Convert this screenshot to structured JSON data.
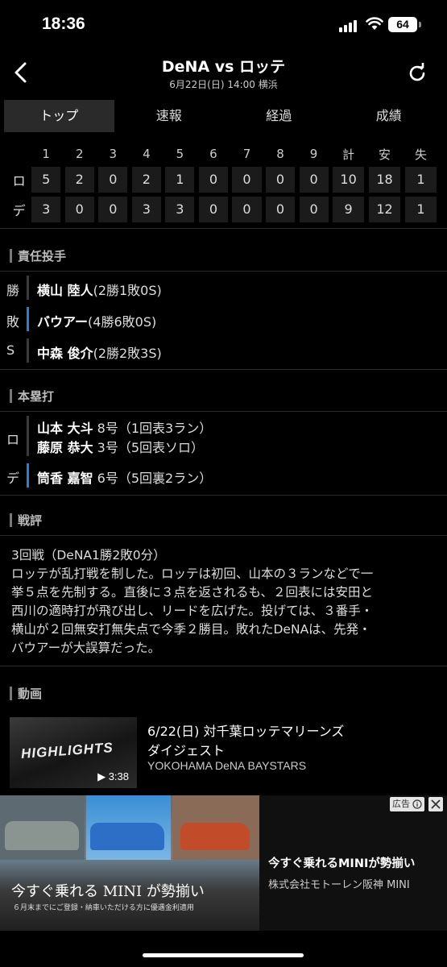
{
  "status_bar": {
    "time": "18:36",
    "battery": "64"
  },
  "header": {
    "title": "DeNA vs ロッテ",
    "subtitle": "6月22日(日) 14:00 横浜"
  },
  "tabs": [
    {
      "label": "トップ",
      "active": true
    },
    {
      "label": "速報",
      "active": false
    },
    {
      "label": "経過",
      "active": false
    },
    {
      "label": "成績",
      "active": false
    }
  ],
  "scoreboard": {
    "columns": [
      "1",
      "2",
      "3",
      "4",
      "5",
      "6",
      "7",
      "8",
      "9",
      "計",
      "安",
      "失"
    ],
    "rows": [
      {
        "team": "ロ",
        "cells": [
          "5",
          "2",
          "0",
          "2",
          "1",
          "0",
          "0",
          "0",
          "0",
          "10",
          "18",
          "1"
        ]
      },
      {
        "team": "デ",
        "cells": [
          "3",
          "0",
          "0",
          "3",
          "3",
          "0",
          "0",
          "0",
          "0",
          "9",
          "12",
          "1"
        ]
      }
    ]
  },
  "pitchers": {
    "title": "責任投手",
    "rows": [
      {
        "key": "勝",
        "name": "横山 陸人",
        "record": "(2勝1敗0S)"
      },
      {
        "key": "敗",
        "name": "バウアー",
        "record": "(4勝6敗0S)"
      },
      {
        "key": "S",
        "name": "中森 俊介",
        "record": "(2勝2敗3S)"
      }
    ]
  },
  "homeruns": {
    "title": "本塁打",
    "groups": [
      {
        "key": "ロ",
        "entries": [
          {
            "name": "山本 大斗",
            "detail": "8号（1回表3ラン）"
          },
          {
            "name": "藤原 恭大",
            "detail": "3号（5回表ソロ）"
          }
        ]
      },
      {
        "key": "デ",
        "entries": [
          {
            "name": "筒香 嘉智",
            "detail": "6号（5回裏2ラン）"
          }
        ]
      }
    ]
  },
  "review": {
    "title": "戦評",
    "lines": [
      "3回戦（DeNA1勝2敗0分）",
      "ロッテが乱打戦を制した。ロッテは初回、山本の３ランなどで一",
      "挙５点を先制する。直後に３点を返されるも、２回表には安田と",
      "西川の適時打が飛び出し、リードを広げた。投げては、３番手・",
      "横山が２回無安打無失点で今季２勝目。敗れたDeNAは、先発・",
      "バウアーが大誤算だった。"
    ]
  },
  "video": {
    "title": "動画",
    "thumb_text": "HIGHLIGHTS",
    "duration": "▶ 3:38",
    "line1": "6/22(日) 対千葉ロッテマリーンズ",
    "line2": "ダイジェスト",
    "source": "YOKOHAMA DeNA BAYSTARS"
  },
  "ad": {
    "badge": "広告",
    "headline": "今すぐ乗れる MINI が勢揃い",
    "fine_print": "６月末までにご登録・納車いただける方に優遇金利適用",
    "title": "今すぐ乗れるMINIが勢揃い",
    "sponsor": "株式会社モトーレン阪神 MINI"
  }
}
